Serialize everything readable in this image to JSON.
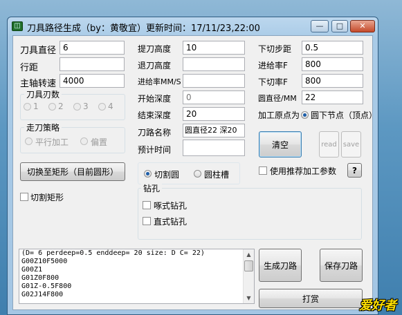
{
  "window": {
    "title": "刀具路径生成（by：黄敬宜）更新时间：17/11/23,22:00",
    "minimize_label": "—",
    "maximize_label": "□",
    "close_label": "✕"
  },
  "left": {
    "tool_diameter_label": "刀具直径",
    "tool_diameter_value": "6",
    "row_pitch_label": "行距",
    "row_pitch_value": "",
    "spindle_label": "主轴转速",
    "spindle_value": "4000",
    "blade_group_title": "刀具刃数",
    "blades": [
      "1",
      "2",
      "3",
      "4"
    ],
    "strategy_group_title": "走刀策略",
    "strategy_options": [
      "平行加工",
      "偏置"
    ],
    "switch_button": "切换至矩形（目前圆形）",
    "cut_rect_label": "切割矩形"
  },
  "middle": {
    "lift_height_label": "提刀高度",
    "lift_height_value": "10",
    "retract_height_label": "退刀高度",
    "retract_height_value": "",
    "feed_rate_label": "进给率MM/S",
    "feed_rate_value": "",
    "start_depth_label": "开始深度",
    "start_depth_value": "0",
    "end_depth_label": "结束深度",
    "end_depth_value": "20",
    "path_name_label": "刀路名称",
    "path_name_value": "圆直径22 深20",
    "est_time_label": "预计时间",
    "est_time_value": "",
    "shape_options": [
      "切割圆",
      "圆柱槽"
    ],
    "drill_group_title": "钻孔",
    "drill_options": [
      "啄式钻孔",
      "直式钻孔"
    ]
  },
  "right": {
    "step_down_label": "下切步距",
    "step_down_value": "0.5",
    "feed_f_label": "进给率F",
    "feed_f_value": "800",
    "plunge_f_label": "下切率F",
    "plunge_f_value": "800",
    "circle_dia_label": "圆直径/MM",
    "circle_dia_value": "22",
    "origin_label": "加工原点为",
    "origin_option": "圆下节点（顶点）",
    "clear_button": "清空",
    "read_button": "read",
    "save_button": "save",
    "recommend_label": "使用推荐加工参数",
    "help_button": "?",
    "generate_button": "生成刀路",
    "save_path_button": "保存刀路",
    "donate_button": "打赏"
  },
  "output_lines": [
    "(D= 6 perdeep=0.5 enddeep= 20 size: D C= 22)",
    "G00Z10F5000",
    "G00Z1",
    "G01Z0F800",
    "G01Z-0.5F800",
    "G02J14F800"
  ],
  "watermark": "爱好者"
}
